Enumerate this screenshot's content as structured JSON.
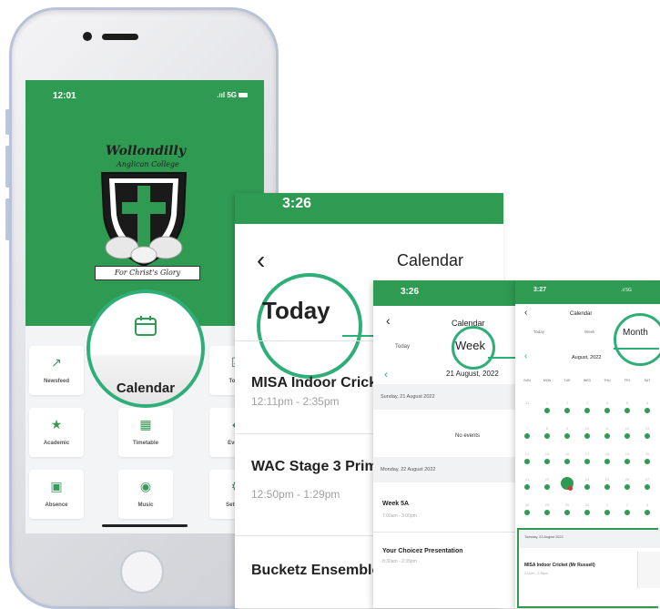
{
  "phone": {
    "status_time": "12:01",
    "status_right": ".ııl 5G",
    "crest_title": "Wollondilly",
    "crest_subtitle": "Anglican College",
    "motto": "For Christ's Glory",
    "tiles": [
      {
        "label": "Newsfeed",
        "icon": "trend-icon"
      },
      {
        "label": "Calendar",
        "icon": "calendar-icon"
      },
      {
        "label": "To-Do",
        "icon": "todo-icon"
      },
      {
        "label": "Academic",
        "icon": "academic-icon"
      },
      {
        "label": "Timetable",
        "icon": "timetable-icon"
      },
      {
        "label": "Events",
        "icon": "ticket-icon"
      },
      {
        "label": "Absence",
        "icon": "absence-icon"
      },
      {
        "label": "Music",
        "icon": "music-icon"
      },
      {
        "label": "Settings",
        "icon": "settings-icon"
      }
    ],
    "calendar_label": "Calendar"
  },
  "screen_today": {
    "time": "3:26",
    "title": "Calendar",
    "tab_today": "Today",
    "events": [
      {
        "title": "MISA Indoor Cricke",
        "time": "12:11pm - 2:35pm"
      },
      {
        "title": "WAC Stage 3 Prim",
        "time": "12:50pm - 1:29pm"
      },
      {
        "title": "Bucketz Ensemble",
        "time": ""
      }
    ]
  },
  "screen_week": {
    "time": "3:26",
    "title": "Calendar",
    "tab_today": "Today",
    "tab_week": "Week",
    "date": "21 August, 2022",
    "sections": [
      {
        "heading": "Sunday, 21 August 2022",
        "empty_text": "No events"
      },
      {
        "heading": "Monday, 22 August 2022"
      }
    ],
    "events": [
      {
        "title": "Week 5A",
        "time": "7:00am - 3:00pm"
      },
      {
        "title": "Your Choicez Presentation",
        "time": "8:30am - 2:35pm"
      }
    ]
  },
  "screen_month": {
    "time": "3:27",
    "status_right": ".ıl 5G",
    "title": "Calendar",
    "tab_today": "Today",
    "tab_week": "Week",
    "tab_month": "Month",
    "month_label": "August, 2022",
    "days_of_week": [
      "SUN",
      "MON",
      "TUE",
      "WED",
      "THU",
      "FRI",
      "SAT"
    ],
    "weeks": [
      [
        "31",
        "1",
        "2",
        "3",
        "4",
        "5",
        "6"
      ],
      [
        "7",
        "8",
        "9",
        "10",
        "11",
        "12",
        "13"
      ],
      [
        "14",
        "15",
        "16",
        "17",
        "18",
        "19",
        "20"
      ],
      [
        "21",
        "22",
        "23",
        "24",
        "25",
        "26",
        "27"
      ],
      [
        "28",
        "29",
        "30",
        "31",
        "1",
        "2",
        "3"
      ]
    ],
    "selected_day": "23",
    "selected_heading": "Tuesday, 23 August 2022",
    "selected_event": "MISA Indoor Cricket (Mr Russell)",
    "selected_time": "2:11pm - 2:35pm"
  }
}
